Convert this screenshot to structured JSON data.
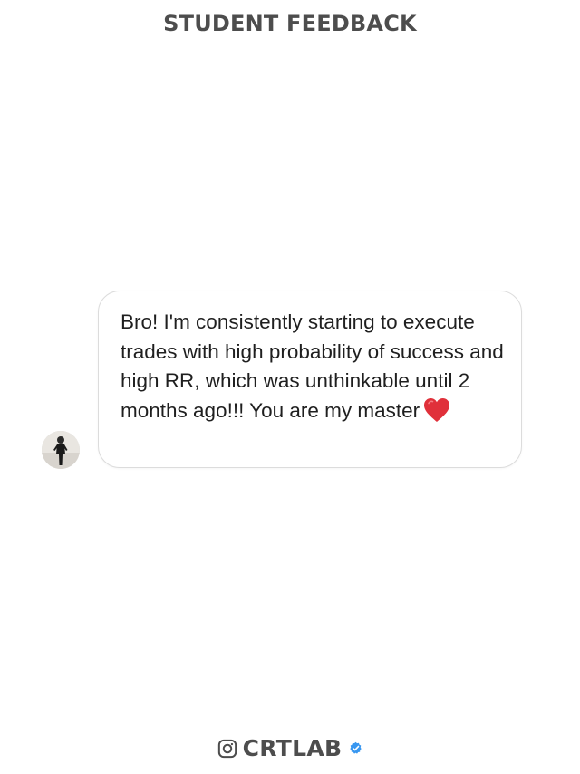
{
  "header": {
    "title": "STUDENT FEEDBACK"
  },
  "message": {
    "text": "Bro! I'm consistently starting to execute trades with high probability of success and high RR, which was unthinkable until 2 months ago!!! You are my master",
    "emoji_icon": "red-heart-icon"
  },
  "sender": {
    "avatar_icon": "user-avatar"
  },
  "footer": {
    "brand": "CRTLAB",
    "platform_icon": "instagram-icon",
    "badge_icon": "verified-badge-icon"
  },
  "colors": {
    "title": "#4d4d4d",
    "bubble_border": "#dcdcdc",
    "message_text": "#1f1f1f",
    "heart": "#e0303a",
    "verified": "#3897f0"
  }
}
